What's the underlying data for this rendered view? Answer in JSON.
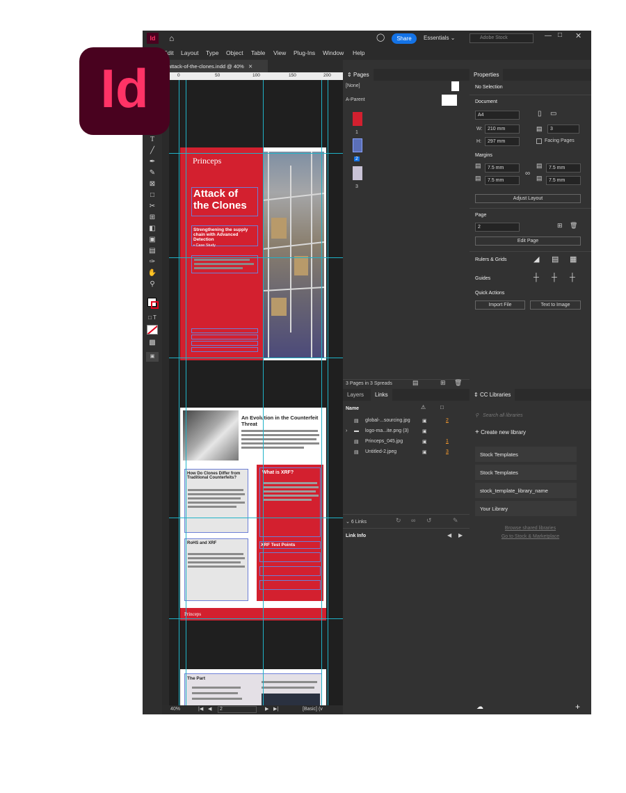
{
  "app": {
    "logo_text": "Id",
    "share_label": "Share",
    "workspace": "Essentials",
    "search_placeholder": "Adobe Stock",
    "menu": [
      "Edit",
      "Layout",
      "Type",
      "Object",
      "Table",
      "View",
      "Plug-Ins",
      "Window",
      "Help"
    ],
    "doc_tab": "*attack-of-the-clones.indd @ 40%",
    "ruler_ticks": [
      "0",
      "50",
      "100",
      "150",
      "200"
    ]
  },
  "canvas": {
    "page1": {
      "brand": "Princeps",
      "title_line1": "Attack of",
      "title_line2": "the Clones",
      "subtitle": "Strengthening the supply chain with Advanced Detection",
      "tag": "• Case Study"
    },
    "page2": {
      "heading": "An Evolution in the Counterfeit Threat",
      "box1_title": "How Do Clones Differ from Traditional Counterfeits?",
      "box2_title": "What is XRF?",
      "box3_title": "RoHS and XRF",
      "box4_title": "XRF Test Points",
      "footer_brand": "Princeps"
    },
    "page3": {
      "heading": "The Part"
    }
  },
  "statusbar": {
    "zoom": "40%",
    "page": "2",
    "style": "[Basic] (v"
  },
  "pages_panel": {
    "title": "Pages",
    "none_label": "[None]",
    "parent_label": "A-Parent",
    "page_numbers": [
      "1",
      "2",
      "3"
    ],
    "footer": "3 Pages in 3 Spreads"
  },
  "links_panel": {
    "tabs": [
      "Layers",
      "Links"
    ],
    "column_name": "Name",
    "rows": [
      {
        "name": "global-...sourcing.jpg",
        "page": "2"
      },
      {
        "name": "logo-ma...ite.png (3)",
        "page": ""
      },
      {
        "name": "Princeps_045.jpg",
        "page": "1"
      },
      {
        "name": "Untitled-2.jpeg",
        "page": "3"
      }
    ],
    "count": "6 Links",
    "link_info": "Link Info"
  },
  "properties": {
    "title": "Properties",
    "selection": "No Selection",
    "document_label": "Document",
    "size": "A4",
    "width_label": "W:",
    "width": "210 mm",
    "height_label": "H:",
    "height": "297 mm",
    "pages_count": "3",
    "facing_pages": "Facing Pages",
    "margins_label": "Margins",
    "margin_values": [
      "7.5 mm",
      "7.5 mm",
      "7.5 mm",
      "7.5 mm"
    ],
    "adjust_layout": "Adjust Layout",
    "page_label": "Page",
    "page_value": "2",
    "edit_page": "Edit Page",
    "rulers_grids": "Rulers & Grids",
    "guides": "Guides",
    "quick_actions": "Quick Actions",
    "import_file": "Import File",
    "text_to_image": "Text to Image"
  },
  "cc_libraries": {
    "title": "CC Libraries",
    "search_placeholder": "Search all libraries",
    "create_new": "Create new library",
    "libraries": [
      "Stock Templates",
      "Stock Templates",
      "stock_template_library_name",
      "Your Library"
    ],
    "browse_shared": "Browse shared libraries",
    "goto_stock": "Go to Stock & Marketplace"
  },
  "colors": {
    "accent_red": "#d3202f",
    "logo_bg": "#49021f",
    "logo_fg": "#ff3366",
    "share_blue": "#1473e6",
    "guide_cyan": "#1fb3c8"
  }
}
